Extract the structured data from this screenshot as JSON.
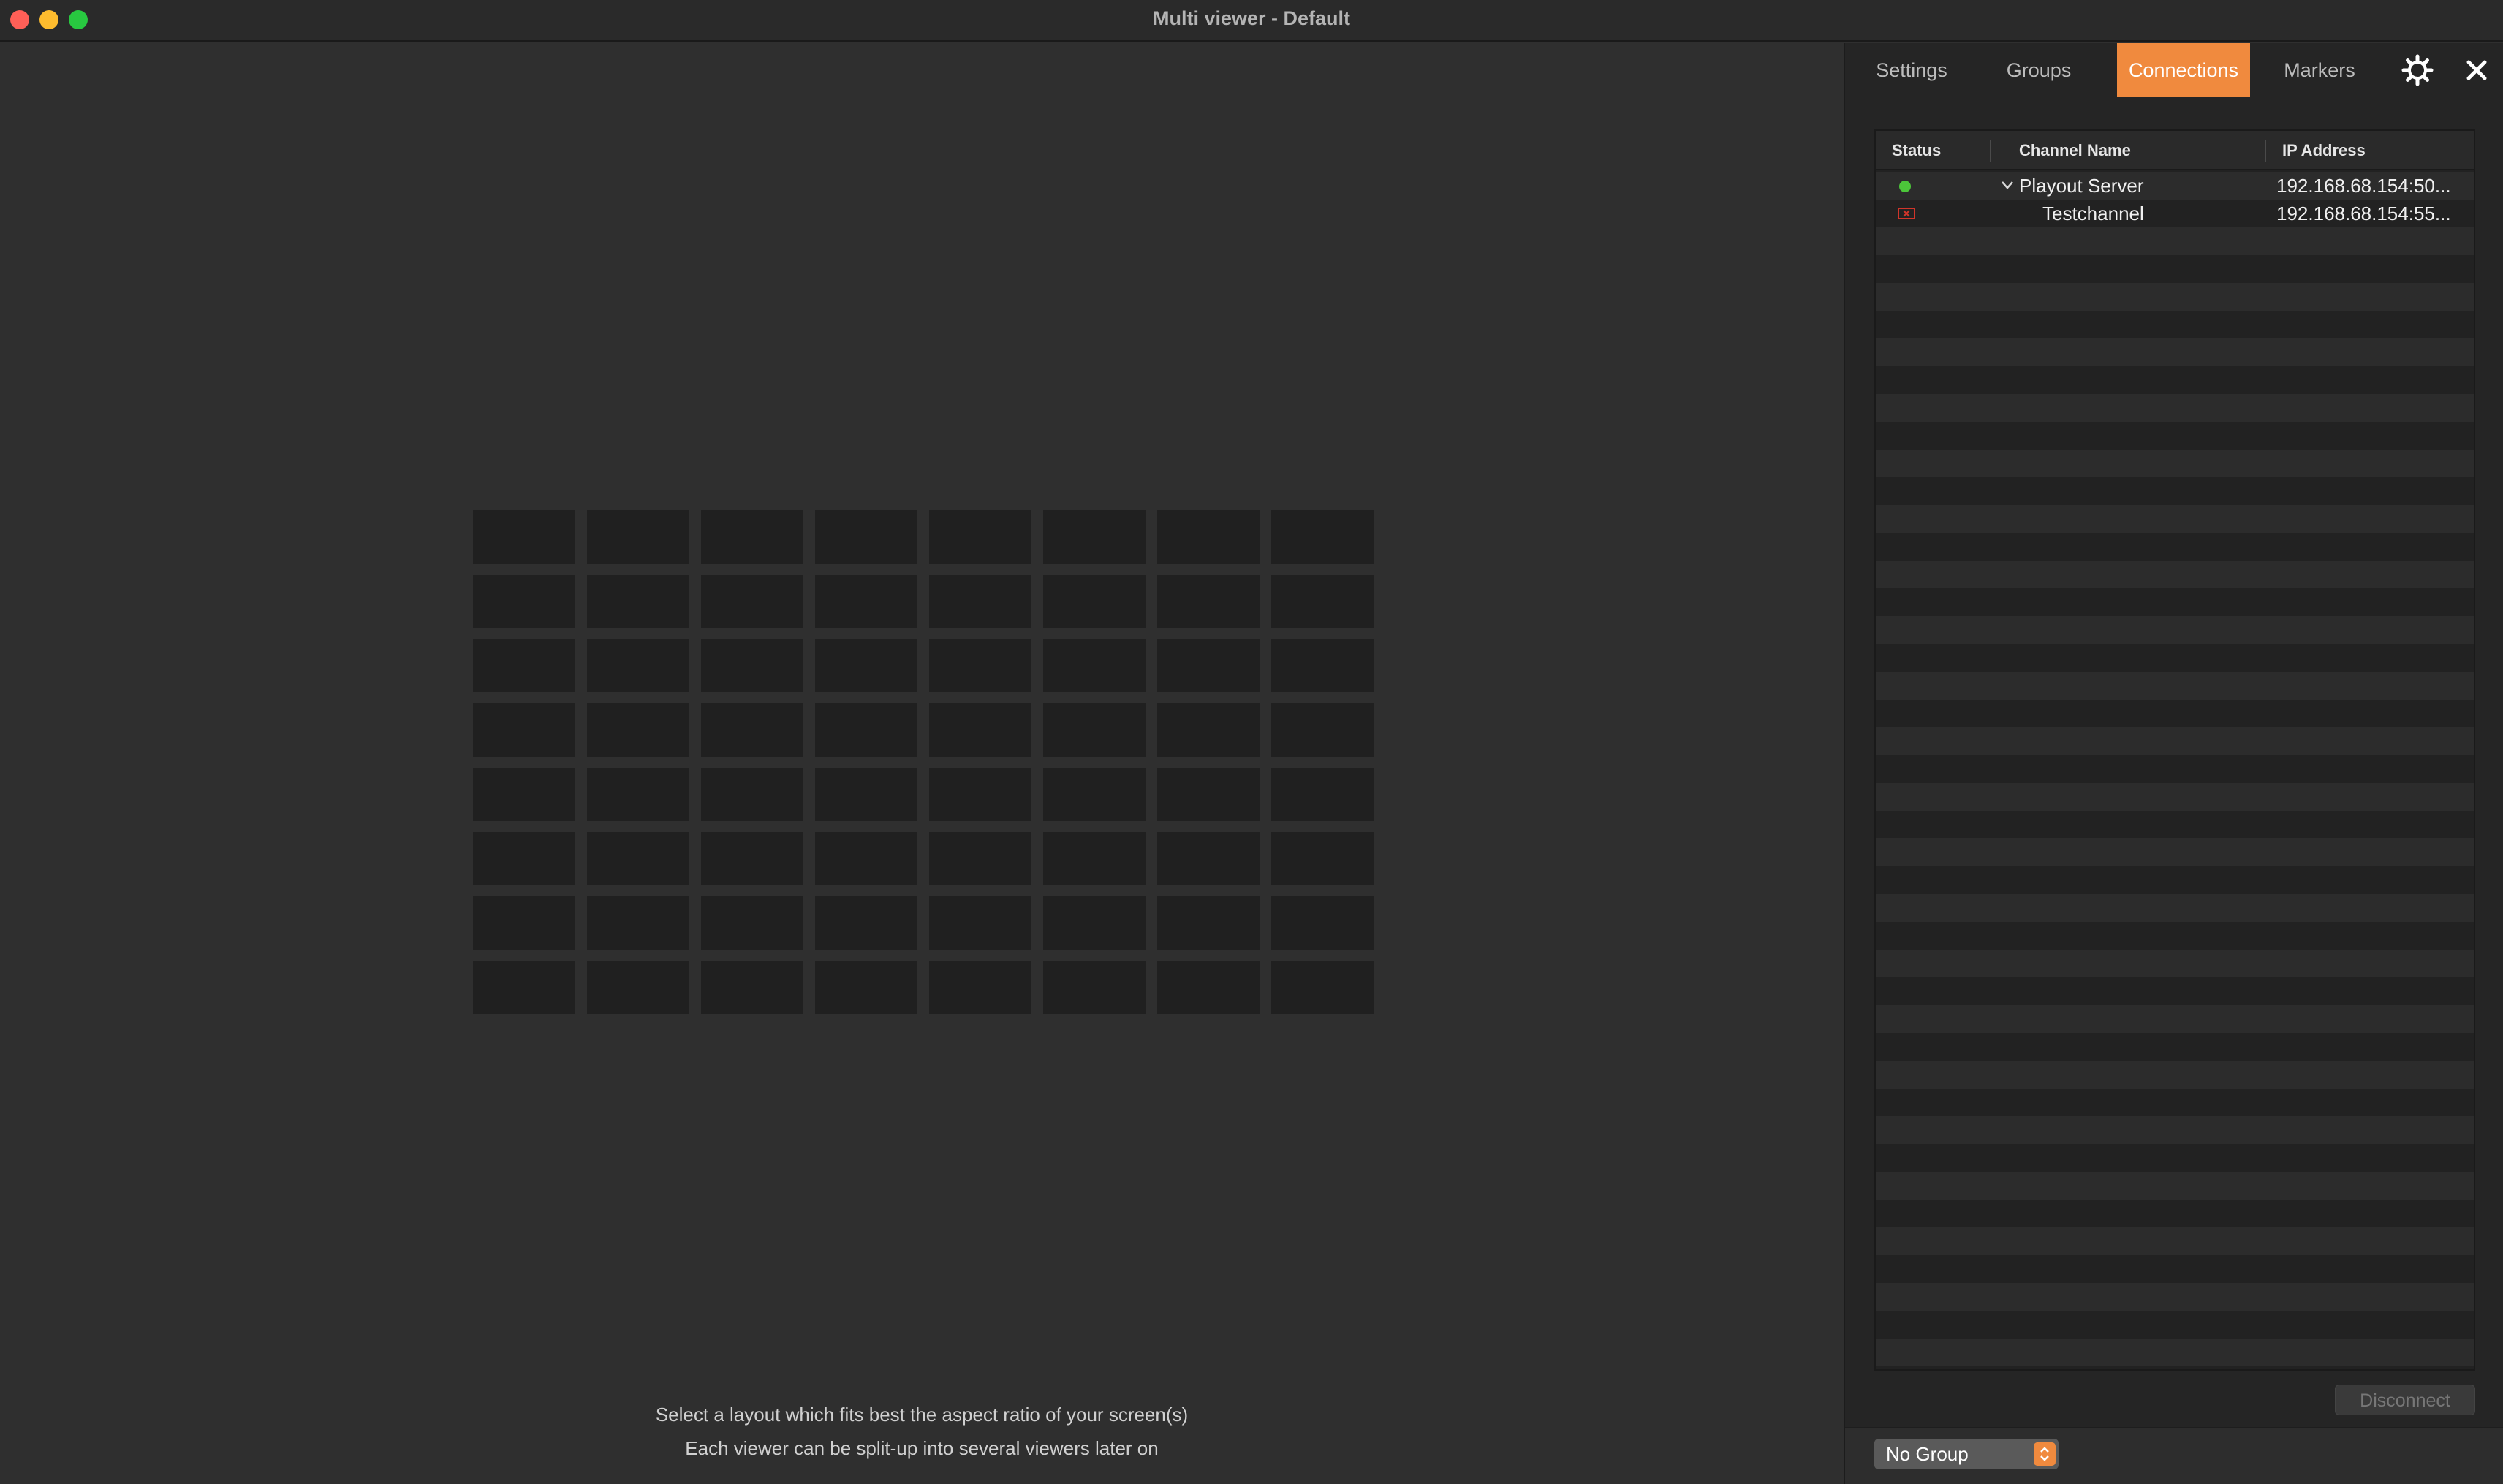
{
  "window": {
    "title": "Multi viewer - Default",
    "traffic_lights": [
      "close",
      "minimize",
      "maximize"
    ]
  },
  "layout_grid": {
    "columns": 8,
    "rows": 8
  },
  "hints": {
    "line1": "Select a layout which fits best the aspect ratio of your screen(s)",
    "line2": "Each viewer can be split-up into several viewers later on"
  },
  "panel": {
    "tabs": [
      {
        "label": "Settings",
        "active": false
      },
      {
        "label": "Groups",
        "active": false
      },
      {
        "label": "Connections",
        "active": true
      },
      {
        "label": "Markers",
        "active": false
      }
    ],
    "icons": {
      "settings": "gear-icon",
      "close": "close-icon"
    },
    "table": {
      "columns": [
        "Status",
        "Channel Name",
        "IP Address"
      ],
      "rows": [
        {
          "status": "connected",
          "status_color": "#4cc63a",
          "channel": "Playout Server",
          "ip": "192.168.68.154:50...",
          "expanded": true
        },
        {
          "status": "error",
          "status_color": "#d0352a",
          "channel": "Testchannel",
          "ip": "192.168.68.154:55..."
        }
      ]
    },
    "disconnect_label": "Disconnect",
    "group_select": {
      "value": "No Group"
    }
  },
  "colors": {
    "accent": "#f08a3e",
    "background": "#2f2f2f",
    "panel": "#252525",
    "grid_cell": "#202020"
  }
}
